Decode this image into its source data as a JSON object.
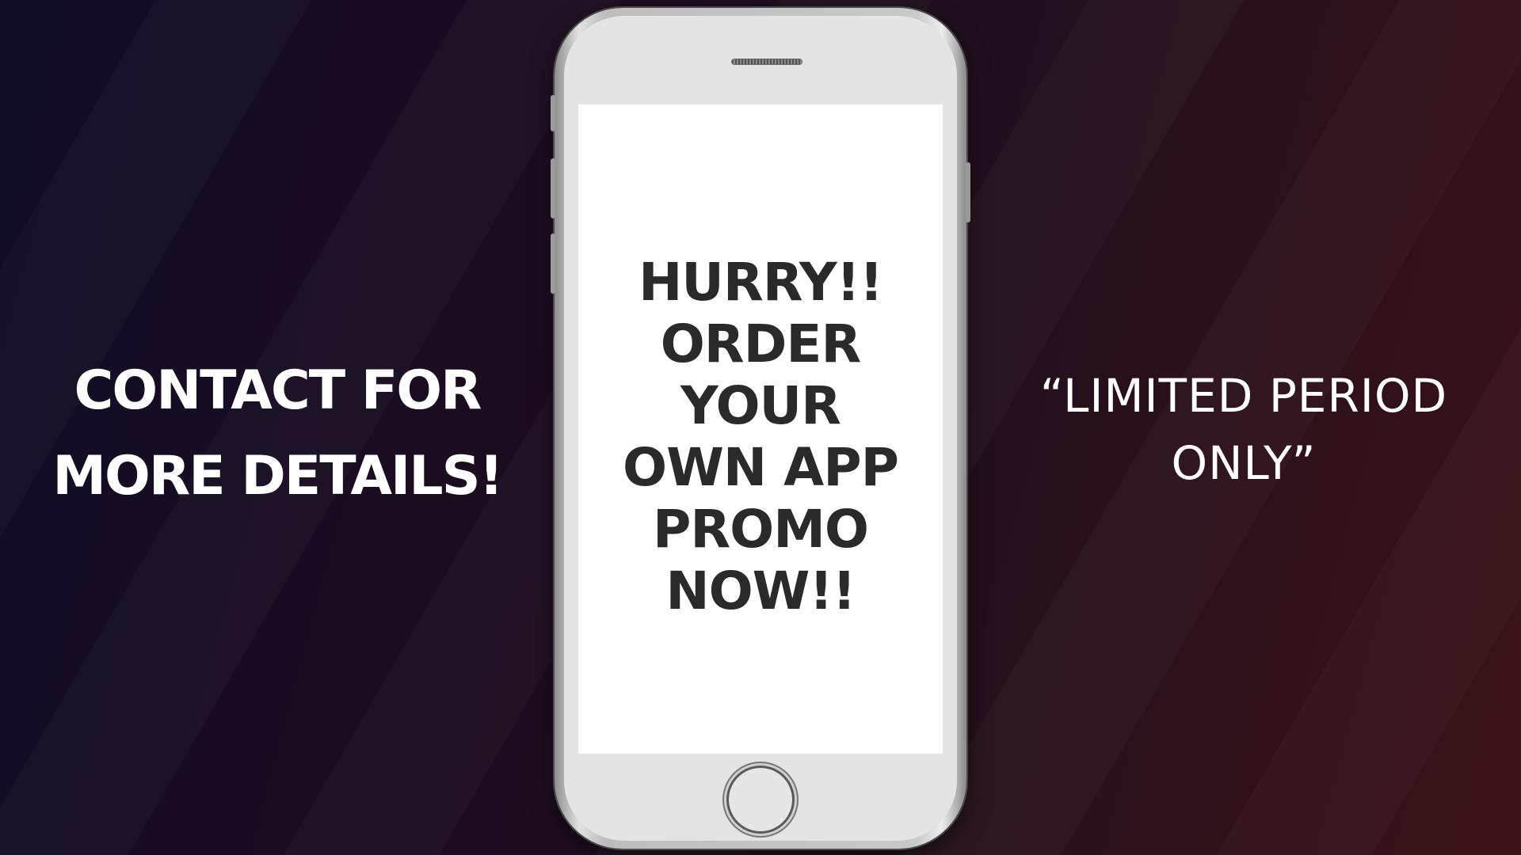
{
  "left": {
    "lines": [
      "CONTACT FOR",
      "MORE DETAILS!"
    ]
  },
  "phone": {
    "screen_lines": [
      "HURRY!!",
      "ORDER",
      "YOUR",
      "OWN APP",
      "PROMO",
      "NOW!!"
    ]
  },
  "right": {
    "lines": [
      "“LIMITED PERIOD",
      "ONLY”"
    ]
  },
  "colors": {
    "background_left": "#100c26",
    "background_right": "#3a1218",
    "screen_text": "#2a2a2a",
    "side_text": "#ffffff"
  }
}
